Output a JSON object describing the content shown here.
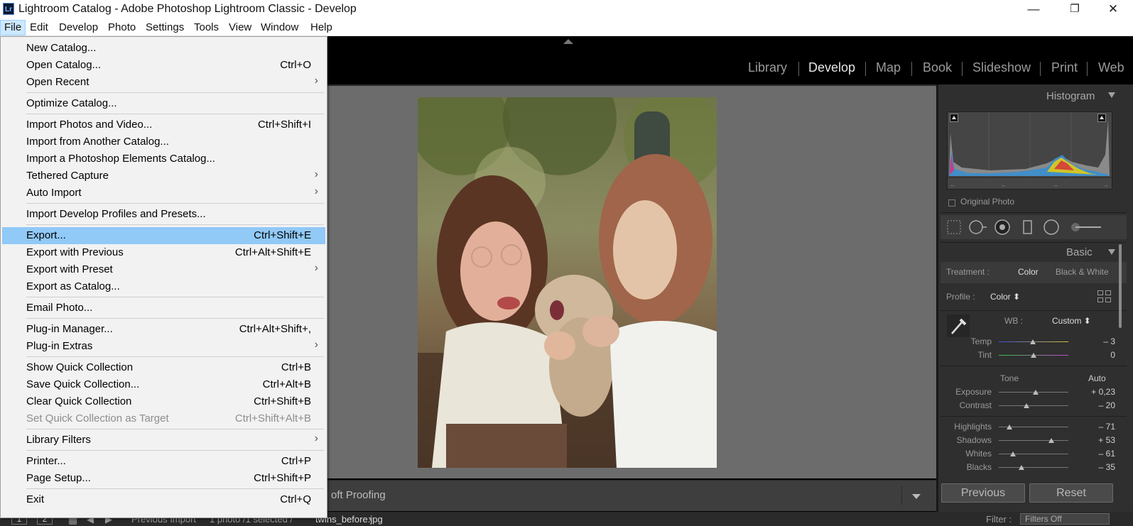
{
  "window": {
    "app_icon": "Lr",
    "title": "Lightroom Catalog - Adobe Photoshop Lightroom Classic - Develop",
    "minimize_glyph": "—",
    "restore_glyph": "❐",
    "close_glyph": "✕"
  },
  "menubar": {
    "items": [
      "File",
      "Edit",
      "Develop",
      "Photo",
      "Settings",
      "Tools",
      "View",
      "Window",
      "Help"
    ]
  },
  "modules": [
    "Library",
    "Develop",
    "Map",
    "Book",
    "Slideshow",
    "Print",
    "Web"
  ],
  "file_menu": {
    "items": [
      {
        "label": "New Catalog...",
        "shortcut": ""
      },
      {
        "label": "Open Catalog...",
        "shortcut": "Ctrl+O"
      },
      {
        "label": "Open Recent",
        "shortcut": "",
        "submenu": true
      },
      {
        "label": "Optimize Catalog...",
        "shortcut": ""
      },
      {
        "label": "Import Photos and Video...",
        "shortcut": "Ctrl+Shift+I"
      },
      {
        "label": "Import from Another Catalog...",
        "shortcut": ""
      },
      {
        "label": "Import a Photoshop Elements Catalog...",
        "shortcut": ""
      },
      {
        "label": "Tethered Capture",
        "shortcut": "",
        "submenu": true
      },
      {
        "label": "Auto Import",
        "shortcut": "",
        "submenu": true
      },
      {
        "label": "Import Develop Profiles and Presets...",
        "shortcut": ""
      },
      {
        "label": "Export...",
        "shortcut": "Ctrl+Shift+E",
        "highlighted": true
      },
      {
        "label": "Export with Previous",
        "shortcut": "Ctrl+Alt+Shift+E"
      },
      {
        "label": "Export with Preset",
        "shortcut": "",
        "submenu": true
      },
      {
        "label": "Export as Catalog...",
        "shortcut": ""
      },
      {
        "label": "Email Photo...",
        "shortcut": ""
      },
      {
        "label": "Plug-in Manager...",
        "shortcut": "Ctrl+Alt+Shift+,"
      },
      {
        "label": "Plug-in Extras",
        "shortcut": "",
        "submenu": true
      },
      {
        "label": "Show Quick Collection",
        "shortcut": "Ctrl+B"
      },
      {
        "label": "Save Quick Collection...",
        "shortcut": "Ctrl+Alt+B"
      },
      {
        "label": "Clear Quick Collection",
        "shortcut": "Ctrl+Shift+B"
      },
      {
        "label": "Set Quick Collection as Target",
        "shortcut": "Ctrl+Shift+Alt+B",
        "disabled": true
      },
      {
        "label": "Library Filters",
        "shortcut": "",
        "submenu": true
      },
      {
        "label": "Printer...",
        "shortcut": "Ctrl+P"
      },
      {
        "label": "Page Setup...",
        "shortcut": "Ctrl+Shift+P"
      },
      {
        "label": "Exit",
        "shortcut": "Ctrl+Q"
      }
    ]
  },
  "toolbar": {
    "soft_proofing_label": "oft Proofing"
  },
  "right_panel": {
    "histogram_title": "Histogram",
    "histogram_ticks": [
      "–",
      "–",
      "–",
      "–"
    ],
    "original_photo_label": "Original Photo",
    "basic_title": "Basic",
    "treatment_label": "Treatment :",
    "treatment_color": "Color",
    "treatment_bw": "Black & White",
    "profile_label": "Profile :",
    "profile_value": "Color ⬍",
    "wb_label": "WB :",
    "wb_value": "Custom ⬍",
    "tone_label": "Tone",
    "auto_label": "Auto",
    "sliders": [
      {
        "label": "Temp",
        "value": "– 3",
        "position": 0.49
      },
      {
        "label": "Tint",
        "value": "0",
        "position": 0.5
      },
      {
        "label": "Exposure",
        "value": "+ 0,23",
        "position": 0.53
      },
      {
        "label": "Contrast",
        "value": "– 20",
        "position": 0.4
      },
      {
        "label": "Highlights",
        "value": "– 71",
        "position": 0.15
      },
      {
        "label": "Shadows",
        "value": "+ 53",
        "position": 0.76
      },
      {
        "label": "Whites",
        "value": "– 61",
        "position": 0.2
      },
      {
        "label": "Blacks",
        "value": "– 35",
        "position": 0.33
      }
    ],
    "previous_button": "Previous",
    "reset_button": "Reset"
  },
  "filmstrip": {
    "page1": "1",
    "page2": "2",
    "source": "Previous Import",
    "count": "1 photo /1 selected /",
    "filename": "twins_before.jpg",
    "filter_label": "Filter :",
    "filter_value": "Filters Off"
  },
  "icons": [
    "menu-chevron-right-icon",
    "collapse-triangle-icon",
    "crop-tool-icon",
    "spot-removal-icon",
    "redeye-icon",
    "graduated-filter-icon",
    "radial-filter-icon",
    "brush-icon",
    "eyedropper-icon",
    "grid-icon"
  ]
}
